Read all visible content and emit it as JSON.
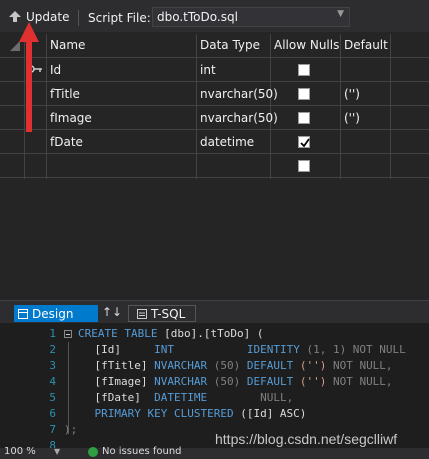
{
  "toolbar": {
    "update_label": "Update",
    "script_file_label": "Script File:",
    "script_file_value": "dbo.tToDo.sql"
  },
  "grid": {
    "columns": [
      "Name",
      "Data Type",
      "Allow Nulls",
      "Default"
    ],
    "rows": [
      {
        "name": "Id",
        "type": "int",
        "allow_nulls": false,
        "default": "",
        "primary_key": true
      },
      {
        "name": "fTitle",
        "type": "nvarchar(50)",
        "allow_nulls": false,
        "default": "('')",
        "primary_key": false
      },
      {
        "name": "fImage",
        "type": "nvarchar(50)",
        "allow_nulls": false,
        "default": "('')",
        "primary_key": false
      },
      {
        "name": "fDate",
        "type": "datetime",
        "allow_nulls": true,
        "default": "",
        "primary_key": false
      },
      {
        "name": "",
        "type": "",
        "allow_nulls": false,
        "default": "",
        "primary_key": false
      }
    ]
  },
  "tabs": {
    "design_label": "Design",
    "swap_label": "↑↓",
    "tsql_label": "T-SQL"
  },
  "editor": {
    "line_numbers": [
      "1",
      "2",
      "3",
      "4",
      "5",
      "6",
      "7",
      "8"
    ],
    "l1": {
      "kw": "CREATE TABLE",
      "rest": " [dbo].[tToDo] ("
    },
    "l2": {
      "col": "    [Id]",
      "type": "INT",
      "extra": "IDENTITY",
      "args": " (1, 1) NOT NULL"
    },
    "l3": {
      "col": "    [fTitle]",
      "type": "NVARCHAR",
      "num": " (50)",
      "kw": " DEFAULT",
      "str": " ('')",
      "tail": " NOT NULL,"
    },
    "l4": {
      "col": "    [fImage]",
      "type": "NVARCHAR",
      "num": " (50)",
      "kw": " DEFAULT",
      "str": " ('')",
      "tail": " NOT NULL,"
    },
    "l5": {
      "col": "    [fDate]",
      "type": "DATETIME",
      "tail": "NULL,"
    },
    "l6": {
      "kw": "    PRIMARY KEY CLUSTERED",
      "rest": " ([Id] ASC)"
    },
    "l7": {
      "rest": ");"
    },
    "l8": {
      "rest": ""
    }
  },
  "status": {
    "zoom": "100 %",
    "issues": "No issues found"
  },
  "watermark": "https://blog.csdn.net/segclliwf",
  "colors": {
    "accent": "#007acc",
    "annotation_arrow": "#e03030"
  }
}
